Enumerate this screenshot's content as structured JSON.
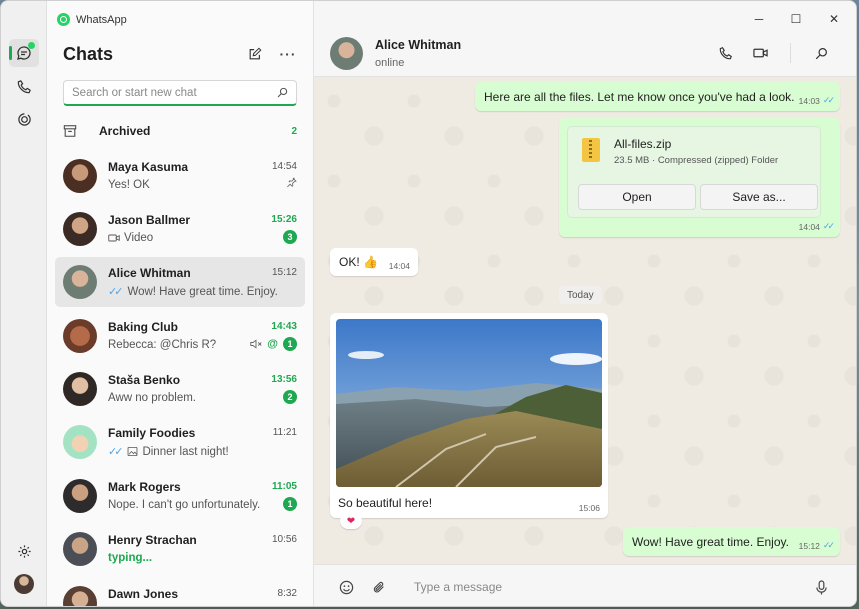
{
  "app": {
    "title": "WhatsApp",
    "accent": "#1da851"
  },
  "sidebar": {
    "title": "Chats"
  },
  "search": {
    "placeholder": "Search or start new chat"
  },
  "archived": {
    "label": "Archived",
    "count": "2"
  },
  "chats": [
    {
      "name": "Maya Kasuma",
      "time": "14:54",
      "preview": "Yes! OK",
      "pinned": true
    },
    {
      "name": "Jason Ballmer",
      "time": "15:26",
      "preview": "Video",
      "unread": "3"
    },
    {
      "name": "Alice Whitman",
      "time": "15:12",
      "preview": "Wow! Have great time. Enjoy."
    },
    {
      "name": "Baking Club",
      "time": "14:43",
      "preview": "Rebecca: @Chris R?",
      "mention": "@",
      "unread": "1"
    },
    {
      "name": "Staša Benko",
      "time": "13:56",
      "preview": "Aww no problem.",
      "unread": "2"
    },
    {
      "name": "Family Foodies",
      "time": "11:21",
      "preview": "Dinner last night!"
    },
    {
      "name": "Mark Rogers",
      "time": "11:05",
      "preview": "Nope. I can't go unfortunately.",
      "unread": "1"
    },
    {
      "name": "Henry Strachan",
      "time": "10:56",
      "preview": "typing..."
    },
    {
      "name": "Dawn Jones",
      "time": "8:32",
      "preview": ""
    }
  ],
  "conversation": {
    "name": "Alice Whitman",
    "status": "online",
    "messages": [
      {
        "text": "Here are all the files. Let me know once you've had a look.",
        "time": "14:03"
      },
      {
        "file_name": "All-files.zip",
        "file_meta": "23.5 MB · Compressed (zipped) Folder",
        "open_label": "Open",
        "save_label": "Save as...",
        "time": "14:04"
      },
      {
        "text": "OK! 👍",
        "time": "14:04"
      },
      {
        "day": "Today"
      },
      {
        "text": "So beautiful here!",
        "time": "15:06",
        "reaction": "❤"
      },
      {
        "text": "Wow! Have great time. Enjoy.",
        "time": "15:12"
      }
    ]
  },
  "composer": {
    "placeholder": "Type a message"
  }
}
